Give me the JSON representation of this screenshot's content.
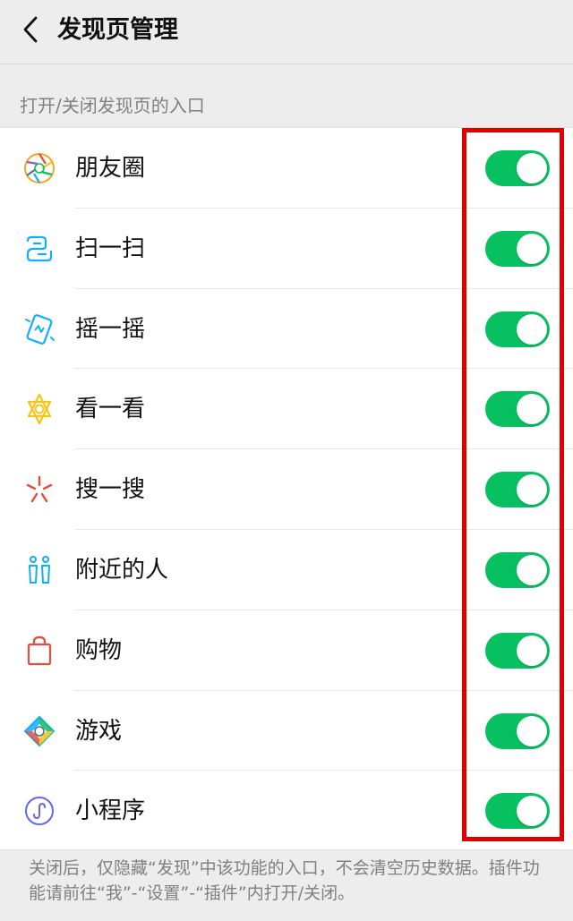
{
  "nav": {
    "title": "发现页管理",
    "back_icon": "chevron-left-icon"
  },
  "section": {
    "title": "打开/关闭发现页的入口"
  },
  "colors": {
    "toggle_on": "#07c160",
    "highlight": "#e00000"
  },
  "items": [
    {
      "label": "朋友圈",
      "icon": "moments-aperture-icon",
      "enabled": true
    },
    {
      "label": "扫一扫",
      "icon": "scan-icon",
      "enabled": true
    },
    {
      "label": "摇一摇",
      "icon": "shake-phone-icon",
      "enabled": true
    },
    {
      "label": "看一看",
      "icon": "top-stories-icon",
      "enabled": true
    },
    {
      "label": "搜一搜",
      "icon": "search-spark-icon",
      "enabled": true
    },
    {
      "label": "附近的人",
      "icon": "people-nearby-icon",
      "enabled": true
    },
    {
      "label": "购物",
      "icon": "shopping-bag-icon",
      "enabled": true
    },
    {
      "label": "游戏",
      "icon": "game-diamond-icon",
      "enabled": true
    },
    {
      "label": "小程序",
      "icon": "mini-program-icon",
      "enabled": true
    }
  ],
  "footer": {
    "note": "关闭后，仅隐藏“发现”中该功能的入口，不会清空历史数据。插件功能请前往“我”-“设置”-“插件”内打开/关闭。"
  }
}
